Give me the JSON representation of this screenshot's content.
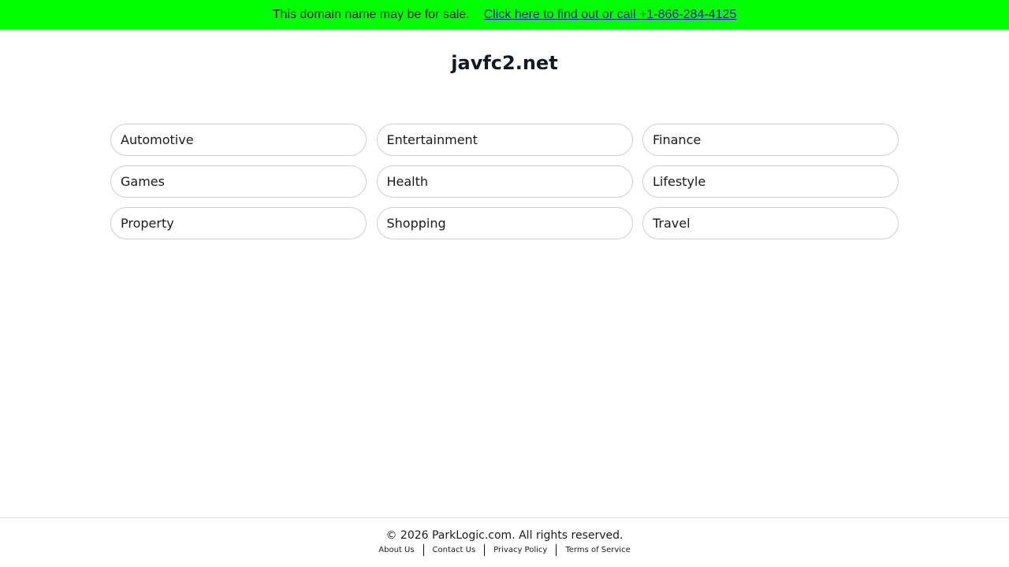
{
  "banner": {
    "text": "This domain name may be for sale.",
    "link": "Click here to find out or call +1-866-284-4125",
    "background": "#00ff00"
  },
  "title": "javfc2.net",
  "categories": [
    "Automotive",
    "Entertainment",
    "Finance",
    "Games",
    "Health",
    "Lifestyle",
    "Property",
    "Shopping",
    "Travel"
  ],
  "footer": {
    "copyright": "© 2026 ParkLogic.com. All rights reserved.",
    "links": [
      "About Us",
      "Contact Us",
      "Privacy Policy",
      "Terms of Service"
    ]
  }
}
